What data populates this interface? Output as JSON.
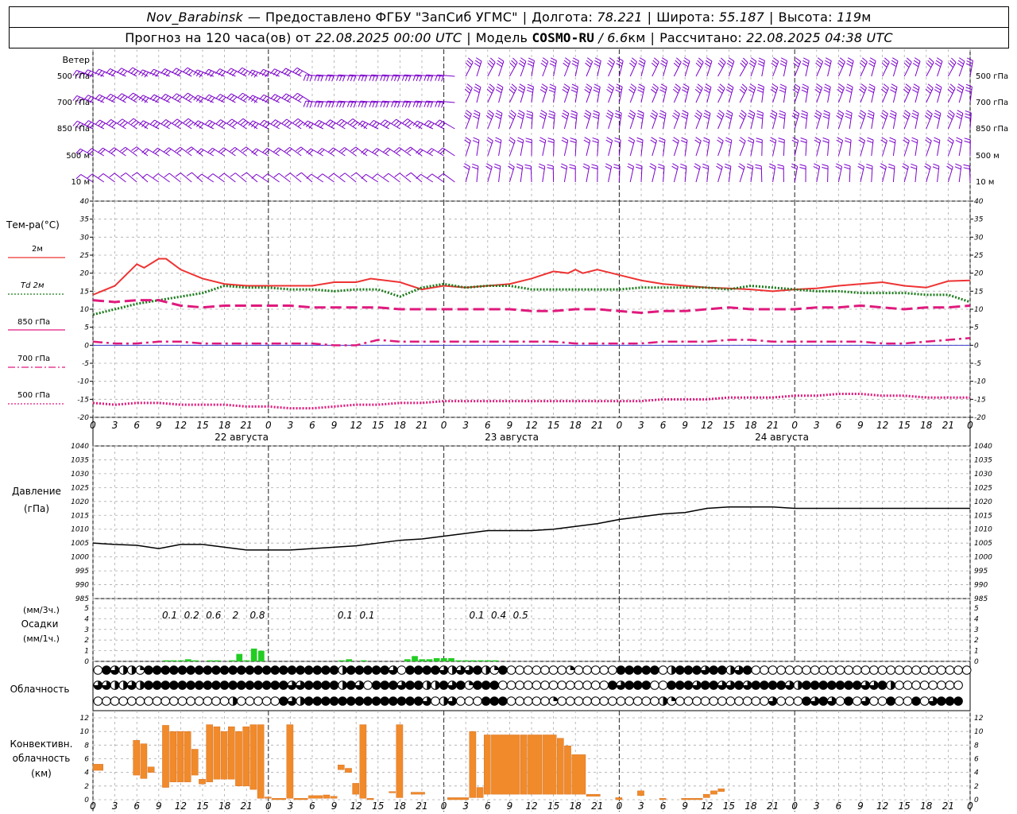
{
  "header": {
    "station": "Nov_Barabinsk",
    "dash": "—",
    "provider": "Предоставлено ФГБУ \"ЗапСиб УГМС\"",
    "lon_label": "Долгота:",
    "lon_value": "78.221",
    "lat_label": "Широта:",
    "lat_value": "55.187",
    "alt_label": "Высота:",
    "alt_value": "119",
    "alt_unit": "м",
    "forecast_prefix": "Прогноз на 120 часа(ов) от",
    "forecast_time": "22.08.2025 00:00 UTC",
    "model_label": "Модель",
    "model_name": "COSMO-RU",
    "model_res": "/ 6.6",
    "model_res_unit": "км",
    "calc_label": "Рассчитано:",
    "calc_time": "22.08.2025 04:38 UTC"
  },
  "wind_panel": {
    "title": "Ветер",
    "levels": [
      "500 гПа",
      "700 гПа",
      "850 гПа",
      "500 м",
      "10  м"
    ],
    "color": "#7b00cc"
  },
  "time_axis": {
    "hour_labels": [
      "0",
      "3",
      "6",
      "9",
      "12",
      "15",
      "18",
      "21",
      "0",
      "3",
      "6",
      "9",
      "12",
      "15",
      "18",
      "21",
      "0",
      "3",
      "6",
      "9",
      "12",
      "15",
      "18",
      "21",
      "0",
      "3",
      "6"
    ],
    "day_labels": [
      "22 августа",
      "23 августа",
      "24 августа"
    ]
  },
  "temp_panel": {
    "title": "Тем-ра(°С)",
    "legend": [
      {
        "label": "2м",
        "color": "#ee3333",
        "style": "solid"
      },
      {
        "label": "Td  2м",
        "color": "#1a7a1a",
        "style": "dotted"
      },
      {
        "label": "850 гПа",
        "color": "#e0197d",
        "style": "dashed"
      },
      {
        "label": "700 гПа",
        "color": "#e0197d",
        "style": "dashdot"
      },
      {
        "label": "500 гПа",
        "color": "#e0197d",
        "style": "dotted"
      }
    ],
    "y_ticks": [
      "40",
      "35",
      "30",
      "25",
      "20",
      "15",
      "10",
      "5",
      "0",
      "-5",
      "-10",
      "-15",
      "-20"
    ]
  },
  "pressure_panel": {
    "title": "Давление",
    "unit": "(гПа)",
    "y_ticks": [
      "1040",
      "1035",
      "1030",
      "1025",
      "1020",
      "1015",
      "1010",
      "1005",
      "1000",
      "995",
      "990",
      "985"
    ]
  },
  "precip_panel": {
    "label_top": "(мм/3ч.)",
    "label_mid": "Осадки",
    "label_bot": "(мм/1ч.)",
    "y_ticks": [
      "5",
      "4",
      "3",
      "2",
      "1",
      "0"
    ],
    "totals": [
      "0.1",
      "0.2",
      "0.6",
      "2",
      "0.8",
      "0.1",
      "0.1",
      "0.1",
      "0.4",
      "0.5"
    ],
    "color": "#22cc22"
  },
  "cloud_panel": {
    "title": "Облачность"
  },
  "conv_panel": {
    "title_1": "Конвективн.",
    "title_2": "облачность",
    "title_3": "(км)",
    "y_ticks": [
      "12",
      "10",
      "8",
      "6",
      "4",
      "2",
      "0"
    ],
    "color": "#f08a2a"
  },
  "chart_data": [
    {
      "type": "line",
      "title": "Тем-ра(°С)",
      "xlabel": "",
      "ylabel": "Тем-ра(°С)",
      "ylim": [
        -20,
        40
      ],
      "x_unit": "hours since 22.08.2025 00:00 UTC",
      "series": [
        {
          "name": "2м",
          "x": [
            0,
            3,
            6,
            7,
            9,
            10,
            12,
            15,
            18,
            21,
            24,
            27,
            30,
            33,
            36,
            38,
            42,
            45,
            48,
            51,
            54,
            57,
            60,
            63,
            65,
            66,
            67,
            69,
            72,
            75,
            78,
            81,
            84,
            87,
            90,
            93,
            96,
            99,
            102,
            105,
            108,
            111,
            114,
            117,
            120
          ],
          "values": [
            14,
            16.5,
            22.5,
            21.5,
            24,
            24,
            21,
            18.5,
            17,
            16.5,
            16.5,
            16.5,
            16.5,
            17.5,
            17.5,
            18.5,
            17.5,
            15.5,
            16.5,
            16,
            16.5,
            17,
            18.5,
            20.5,
            20,
            21,
            20,
            21,
            19.5,
            18,
            17,
            16.5,
            16,
            15.8,
            15.5,
            15,
            15.5,
            15.8,
            16.5,
            17,
            17.5,
            16.5,
            16,
            17.8,
            18
          ]
        },
        {
          "name": "Td  2м",
          "x": [
            0,
            3,
            6,
            9,
            12,
            15,
            18,
            21,
            24,
            27,
            30,
            33,
            36,
            39,
            42,
            45,
            48,
            51,
            54,
            57,
            60,
            63,
            66,
            69,
            72,
            75,
            78,
            81,
            84,
            87,
            90,
            93,
            96,
            99,
            102,
            105,
            108,
            111,
            114,
            117,
            120
          ],
          "values": [
            8.5,
            10,
            11.5,
            12.5,
            13.5,
            14.5,
            16.5,
            16,
            16,
            15.5,
            15.5,
            15,
            15.5,
            15.5,
            13.5,
            16,
            17,
            16,
            16.5,
            16.5,
            15.5,
            15.5,
            15.5,
            15.5,
            15.5,
            16,
            16,
            16,
            16,
            15.5,
            16.5,
            16,
            15.5,
            15,
            15,
            14.5,
            14.5,
            14.5,
            14,
            14,
            12
          ]
        },
        {
          "name": "850 гПа",
          "x": [
            0,
            3,
            6,
            9,
            12,
            15,
            18,
            21,
            24,
            27,
            30,
            33,
            36,
            39,
            42,
            45,
            48,
            51,
            54,
            57,
            60,
            63,
            66,
            69,
            72,
            75,
            78,
            81,
            84,
            87,
            90,
            93,
            96,
            99,
            102,
            105,
            108,
            111,
            114,
            117,
            120
          ],
          "values": [
            12.5,
            12,
            12.5,
            12.5,
            11,
            10.5,
            11,
            11,
            11,
            11,
            10.5,
            10.5,
            10.5,
            10.5,
            10,
            10,
            10,
            10,
            10,
            10,
            9.5,
            9.5,
            10,
            10,
            9.5,
            9,
            9.5,
            9.5,
            10,
            10.5,
            10,
            10,
            10,
            10.5,
            10.5,
            11,
            10.5,
            10,
            10.5,
            10.5,
            11
          ]
        },
        {
          "name": "700 гПа",
          "x": [
            0,
            3,
            6,
            9,
            12,
            15,
            18,
            21,
            24,
            27,
            30,
            33,
            36,
            39,
            42,
            45,
            48,
            51,
            54,
            57,
            60,
            63,
            66,
            69,
            72,
            75,
            78,
            81,
            84,
            87,
            90,
            93,
            96,
            99,
            102,
            105,
            108,
            111,
            114,
            117,
            120
          ],
          "values": [
            1,
            0.5,
            0.5,
            1,
            1,
            0.5,
            0.5,
            0.5,
            0.5,
            0.5,
            0.5,
            0,
            0,
            1.5,
            1,
            1,
            1,
            1,
            1,
            1,
            1,
            1,
            0.5,
            0.5,
            0.5,
            0.5,
            1,
            1,
            1,
            1.5,
            1.5,
            1,
            1,
            1,
            1,
            1,
            0.5,
            0.5,
            1,
            1.5,
            2
          ]
        },
        {
          "name": "500 гПа",
          "x": [
            0,
            3,
            6,
            9,
            12,
            15,
            18,
            21,
            24,
            27,
            30,
            33,
            36,
            39,
            42,
            45,
            48,
            51,
            54,
            57,
            60,
            63,
            66,
            69,
            72,
            75,
            78,
            81,
            84,
            87,
            90,
            93,
            96,
            99,
            102,
            105,
            108,
            111,
            114,
            117,
            120
          ],
          "values": [
            -16,
            -16.5,
            -16,
            -16,
            -16.5,
            -16.5,
            -16.5,
            -17,
            -17,
            -17.5,
            -17.5,
            -17,
            -16.5,
            -16.5,
            -16,
            -16,
            -15.5,
            -15.5,
            -15.5,
            -15.5,
            -15.5,
            -15.5,
            -15.5,
            -15.5,
            -15.5,
            -15.5,
            -15,
            -15,
            -15,
            -14.5,
            -14.5,
            -14.5,
            -14,
            -14,
            -13.5,
            -13.5,
            -14,
            -14,
            -14.5,
            -14.5,
            -14.5
          ]
        }
      ]
    },
    {
      "type": "line",
      "title": "Давление",
      "ylabel": "(гПа)",
      "ylim": [
        985,
        1040
      ],
      "series": [
        {
          "name": "Давление",
          "x": [
            0,
            3,
            6,
            9,
            12,
            15,
            18,
            21,
            24,
            27,
            30,
            33,
            36,
            39,
            42,
            45,
            48,
            51,
            54,
            57,
            60,
            63,
            66,
            69,
            72,
            75,
            78,
            81,
            84,
            87,
            90,
            93,
            96,
            99,
            102,
            105,
            108,
            111,
            114,
            117,
            120
          ],
          "values": [
            1005,
            1004.5,
            1004.2,
            1003,
            1004.5,
            1004.5,
            1003.5,
            1002.5,
            1002.5,
            1002.5,
            1003,
            1003.5,
            1004,
            1005,
            1006,
            1006.5,
            1007.5,
            1008.5,
            1009.5,
            1009.5,
            1009.5,
            1010,
            1011,
            1012,
            1013.5,
            1014.5,
            1015.5,
            1016,
            1017.5,
            1018,
            1018,
            1018,
            1017.5,
            1017.5,
            1017.5,
            1017.5,
            1017.5,
            1017.5,
            1017.5,
            1017.5,
            1017.5
          ]
        }
      ]
    },
    {
      "type": "bar",
      "title": "Осадки",
      "ylabel": "(мм/1ч.)",
      "ylim": [
        0,
        5
      ],
      "x_hours": [
        10,
        11,
        12,
        13,
        14,
        16,
        17,
        19,
        20,
        21,
        22,
        23,
        34,
        35,
        37,
        43,
        44,
        45,
        46,
        47,
        48,
        49,
        50,
        51,
        52,
        53,
        54,
        55
      ],
      "values": [
        0.1,
        0.1,
        0.1,
        0.2,
        0.1,
        0.1,
        0.1,
        0.1,
        0.7,
        0.1,
        1.2,
        1.0,
        0.1,
        0.2,
        0.1,
        0.2,
        0.5,
        0.2,
        0.2,
        0.3,
        0.3,
        0.3,
        0.1,
        0.1,
        0.1,
        0.1,
        0.1,
        0.1
      ],
      "totals_x_hours": [
        10.5,
        13.5,
        16.5,
        19.5,
        22.5,
        34.5,
        37.5,
        52.5,
        55.5,
        58.5
      ],
      "totals_labels": [
        "0.1",
        "0.2",
        "0.6",
        "2",
        "0.8",
        "0.1",
        "0.1",
        "0.1",
        "0.4",
        "0.5"
      ]
    },
    {
      "type": "bar",
      "title": "Конвективн. облачность",
      "ylabel": "(км)",
      "ylim": [
        0,
        13
      ],
      "segments_km": [
        [
          0,
          1.5,
          4.3,
          5.2
        ],
        [
          5.5,
          6.5,
          3.6,
          8.7
        ],
        [
          6.5,
          7.5,
          3.1,
          8.2
        ],
        [
          7.5,
          8.5,
          4.0,
          4.8
        ],
        [
          9.5,
          10.5,
          1.8,
          10.9
        ],
        [
          10.5,
          11.5,
          2.6,
          10.0
        ],
        [
          11.5,
          12.5,
          2.6,
          10.0
        ],
        [
          12.5,
          13.5,
          2.6,
          10.0
        ],
        [
          13.5,
          14.5,
          3.6,
          7.4
        ],
        [
          14.5,
          15.5,
          2.3,
          3.0
        ],
        [
          15.5,
          16.5,
          2.6,
          11.0
        ],
        [
          16.5,
          17.5,
          3.0,
          10.7
        ],
        [
          17.5,
          18.5,
          3.0,
          10.0
        ],
        [
          18.5,
          19.5,
          3.0,
          10.7
        ],
        [
          19.5,
          20.5,
          2.0,
          10.0
        ],
        [
          20.5,
          21.5,
          2.0,
          10.7
        ],
        [
          21.5,
          22.5,
          1.5,
          11.0
        ],
        [
          22.5,
          23.5,
          0.2,
          11.0
        ],
        [
          23.5,
          24.5,
          0.2,
          0.4
        ],
        [
          24.5,
          26.5,
          0.0,
          0.2
        ],
        [
          26.5,
          27.5,
          0.2,
          11.0
        ],
        [
          27.5,
          29.5,
          0.0,
          0.2
        ],
        [
          29.5,
          31.5,
          0.2,
          0.6
        ],
        [
          31.5,
          32.5,
          0.2,
          0.7
        ],
        [
          32.5,
          33.5,
          0.2,
          0.5
        ],
        [
          33.5,
          34.5,
          4.4,
          5.1
        ],
        [
          34.5,
          35.5,
          4.0,
          4.6
        ],
        [
          35.5,
          36.5,
          0.8,
          2.4
        ],
        [
          36.5,
          37.5,
          0.2,
          11.0
        ],
        [
          37.5,
          38.5,
          0.0,
          0.2
        ],
        [
          40.5,
          41.5,
          1.0,
          1.2
        ],
        [
          41.5,
          42.5,
          0.3,
          11.0
        ],
        [
          43.5,
          45.5,
          0.8,
          1.1
        ],
        [
          48.5,
          51.5,
          0.0,
          0.3
        ],
        [
          51.5,
          52.5,
          0.3,
          10.0
        ],
        [
          52.5,
          53.5,
          0.3,
          1.8
        ],
        [
          53.5,
          54.5,
          0.8,
          9.5
        ],
        [
          54.5,
          58.5,
          0.8,
          9.5
        ],
        [
          58.5,
          59.5,
          0.8,
          9.5
        ],
        [
          59.5,
          61.5,
          0.8,
          9.5
        ],
        [
          61.5,
          63.5,
          0.8,
          9.5
        ],
        [
          63.5,
          64.5,
          0.8,
          9.0
        ],
        [
          64.5,
          65.5,
          0.8,
          7.9
        ],
        [
          65.5,
          67.5,
          0.8,
          6.6
        ],
        [
          67.5,
          69.5,
          0.5,
          0.8
        ],
        [
          71.5,
          72.5,
          0.0,
          0.3
        ],
        [
          74.5,
          75.5,
          0.6,
          1.3
        ],
        [
          77.5,
          78.5,
          0.0,
          0.2
        ],
        [
          80.5,
          83.5,
          0.0,
          0.2
        ],
        [
          83.5,
          84.5,
          0.3,
          0.8
        ],
        [
          84.5,
          85.5,
          0.8,
          1.3
        ],
        [
          85.5,
          86.5,
          1.2,
          1.6
        ]
      ]
    }
  ]
}
